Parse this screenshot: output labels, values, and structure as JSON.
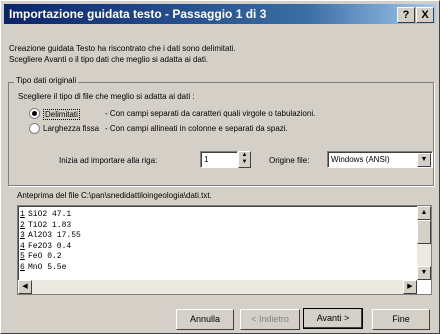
{
  "title": "Importazione guidata testo - Passaggio 1 di 3",
  "title_buttons": {
    "help": "?",
    "close": "X"
  },
  "intro": [
    "Creazione guidata Testo ha riscontrato che i dati sono delimitati.",
    "Scegliere Avanti o il tipo dati che meglio si adatta ai dati."
  ],
  "group": {
    "legend": "Tipo dati originali",
    "heading": "Scegliere il tipo di file che meglio si adatta ai dati :",
    "options": [
      {
        "label": "Delimitati",
        "desc": "- Con campi separati da caratteri quali virgole o tabulazioni.",
        "selected": true
      },
      {
        "label": "Larghezza fissa",
        "desc": "- Con campi allineati in colonne e separati da spazi.",
        "selected": false
      }
    ],
    "start_row_label": "Inizia ad importare alla riga:",
    "start_row_value": "1",
    "origin_label": "Origine file:",
    "origin_value": "Windows (ANSI)"
  },
  "preview": {
    "label": "Anteprima del file C:\\pan\\snedidattiloingeologia\\dati.txt.",
    "rows": [
      {
        "n": "1",
        "text": "SiO2     47.1"
      },
      {
        "n": "2",
        "text": "TiO2 1.83"
      },
      {
        "n": "3",
        "text": "Al2O3 17.55"
      },
      {
        "n": "4",
        "text": "Fe2O3 0.4"
      },
      {
        "n": "5",
        "text": "FeO 0.2"
      },
      {
        "n": "6",
        "text": "MnO 5.5e"
      }
    ]
  },
  "buttons": {
    "cancel": "Annulla",
    "back": "< Indietro",
    "next": "Avanti >",
    "finish": "Fine"
  }
}
